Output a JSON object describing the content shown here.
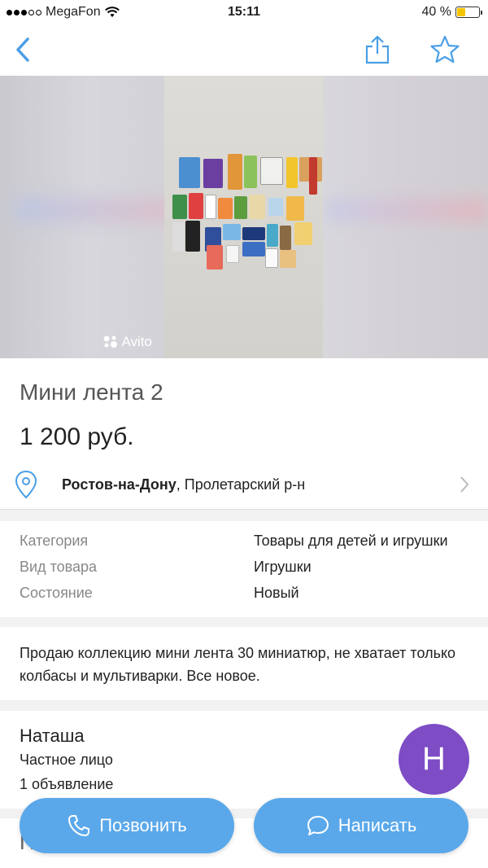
{
  "status_bar": {
    "carrier": "MegaFon",
    "time": "15:11",
    "battery": "40 %",
    "battery_level": 0.4
  },
  "nav": {
    "back_icon": "chevron-left-icon",
    "share_icon": "share-icon",
    "favorite_icon": "star-icon"
  },
  "photo": {
    "watermark": "Avito"
  },
  "listing": {
    "title": "Мини лента 2",
    "price": "1 200 руб."
  },
  "location": {
    "city": "Ростов-на-Дону",
    "district": ", Пролетарский р-н"
  },
  "params": [
    {
      "label": "Категория",
      "value": "Товары для детей и игрушки"
    },
    {
      "label": "Вид товара",
      "value": "Игрушки"
    },
    {
      "label": "Состояние",
      "value": "Новый"
    }
  ],
  "description": "Продаю коллекцию мини лента 30 миниатюр, не хватает только колбасы и мультиварки. Все новое.",
  "seller": {
    "name": "Наташа",
    "type": "Частное лицо",
    "listings": "1 объявление",
    "avatar_letter": "Н"
  },
  "actions": {
    "call": "Позвонить",
    "write": "Написать"
  },
  "colors": {
    "accent": "#5aa8ea",
    "avatar": "#7e4cc5",
    "battery": "#f5c400"
  }
}
